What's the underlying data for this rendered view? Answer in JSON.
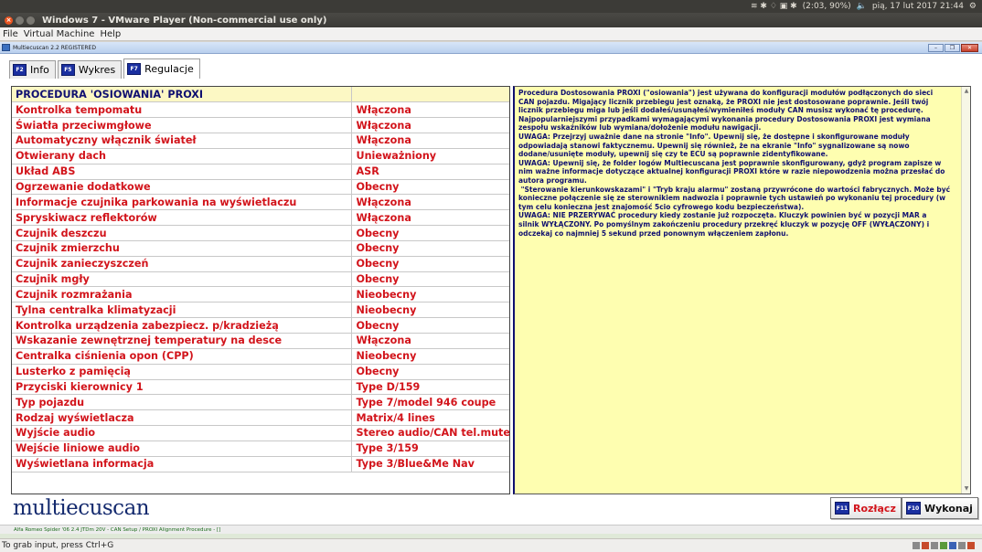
{
  "topbar": {
    "battery": "(2:03, 90%)",
    "datetime": "pią, 17 lut 2017 21:44"
  },
  "vmware": {
    "title": "Windows 7 - VMware Player (Non-commercial use only)",
    "menu": [
      "File",
      "Virtual Machine",
      "Help"
    ],
    "status": "To grab input, press Ctrl+G"
  },
  "guest_window": {
    "title": "Multiecuscan 2.2 REGISTERED"
  },
  "tabs": [
    {
      "key": "F2",
      "label": "Info"
    },
    {
      "key": "F5",
      "label": "Wykres"
    },
    {
      "key": "F7",
      "label": "Regulacje"
    }
  ],
  "table": {
    "header": "PROCEDURA 'OSIOWANIA' PROXI",
    "rows": [
      {
        "name": "Kontrolka tempomatu",
        "value": "Włączona"
      },
      {
        "name": "Światła przeciwmgłowe",
        "value": "Włączona"
      },
      {
        "name": "Automatyczny włącznik świateł",
        "value": "Włączona"
      },
      {
        "name": "Otwierany dach",
        "value": "Unieważniony"
      },
      {
        "name": "Układ ABS",
        "value": "ASR"
      },
      {
        "name": "Ogrzewanie dodatkowe",
        "value": "Obecny"
      },
      {
        "name": "Informacje czujnika parkowania na wyświetlaczu",
        "value": "Włączona"
      },
      {
        "name": "Spryskiwacz reflektorów",
        "value": "Włączona"
      },
      {
        "name": "Czujnik deszczu",
        "value": "Obecny"
      },
      {
        "name": "Czujnik zmierzchu",
        "value": "Obecny"
      },
      {
        "name": "Czujnik zanieczyszczeń",
        "value": "Obecny"
      },
      {
        "name": "Czujnik mgły",
        "value": "Obecny"
      },
      {
        "name": "Czujnik rozmrażania",
        "value": "Nieobecny"
      },
      {
        "name": "Tylna centralka klimatyzacji",
        "value": "Nieobecny"
      },
      {
        "name": "Kontrolka urządzenia zabezpiecz. p/kradzieżą",
        "value": "Obecny"
      },
      {
        "name": "Wskazanie zewnętrznej temperatury na desce",
        "value": "Włączona"
      },
      {
        "name": "Centralka ciśnienia opon (CPP)",
        "value": "Nieobecny"
      },
      {
        "name": "Lusterko z pamięcią",
        "value": "Obecny"
      },
      {
        "name": "Przyciski kierownicy 1",
        "value": "Type D/159"
      },
      {
        "name": "Typ pojazdu",
        "value": "Type 7/model 946 coupe"
      },
      {
        "name": "Rodzaj wyświetlacza",
        "value": "Matrix/4 lines"
      },
      {
        "name": "Wyjście audio",
        "value": "Stereo audio/CAN tel.mute"
      },
      {
        "name": "Wejście liniowe audio",
        "value": "Type 3/159"
      },
      {
        "name": "Wyświetlana informacja",
        "value": "Type 3/Blue&Me Nav"
      }
    ]
  },
  "info_text": "Procedura Dostosowania PROXI (\"osiowania\") jest używana do konfiguracji modułów podłączonych do sieci\nCAN pojazdu. Migający licznik przebiegu jest oznaką, że PROXI nie jest dostosowane poprawnie. Jeśli twój\nlicznik przebiegu miga lub jeśli dodałeś/usunąłeś/wymieniłeś moduły CAN musisz wykonać tę procedurę.\nNajpopularniejszymi przypadkami wymagającymi wykonania procedury Dostosowania PROXI jest wymiana\nzespołu wskaźników lub wymiana/dołożenie modułu nawigacji.\nUWAGA: Przejrzyj uważnie dane na stronie \"Info\". Upewnij się, że dostępne i skonfigurowane moduły\nodpowiadają stanowi faktycznemu. Upewnij się również, że na ekranie \"Info\" sygnalizowane są nowo\ndodane/usunięte moduły, upewnij się czy te ECU są poprawnie zidentyfikowane.\nUWAGA: Upewnij się, że folder logów Multiecuscana jest poprawnie skonfigurowany, gdyż program zapisze w\nnim ważne informacje dotyczące aktualnej konfiguracji PROXI które w razie niepowodzenia można przesłać do\nautora programu.\n \"Sterowanie kierunkowskazami\" i \"Tryb kraju alarmu\" zostaną przywrócone do wartości fabrycznych. Może być\nkonieczne połączenie się ze sterownikiem nadwozia i poprawnie tych ustawień po wykonaniu tej procedury (w\ntym celu konieczna jest znajomość 5cio cyfrowego kodu bezpieczeństwa).\nUWAGA: NIE PRZERYWAĆ procedury kiedy zostanie już rozpoczęta. Kluczyk powinien być w pozycji MAR a\nsilnik WYŁĄCZONY. Po pomyślnym zakończeniu procedury przekręć kluczyk w pozycję OFF (WYŁĄCZONY) i\nodczekaj co najmniej 5 sekund przed ponownym włączeniem zapłonu.",
  "logo": "multiecuscan",
  "buttons": {
    "disconnect": {
      "key": "F11",
      "label": "Rozłącz"
    },
    "execute": {
      "key": "F10",
      "label": "Wykonaj"
    }
  },
  "status_line": "Alfa Romeo Spider '06 2.4 JTDm 20V - CAN Setup / PROXI Alignment Procedure - []",
  "colors": {
    "value_red": "#d2141b",
    "header_navy": "#101070",
    "info_bg": "#fefeb0",
    "fkey_blue": "#1a2fa0"
  }
}
